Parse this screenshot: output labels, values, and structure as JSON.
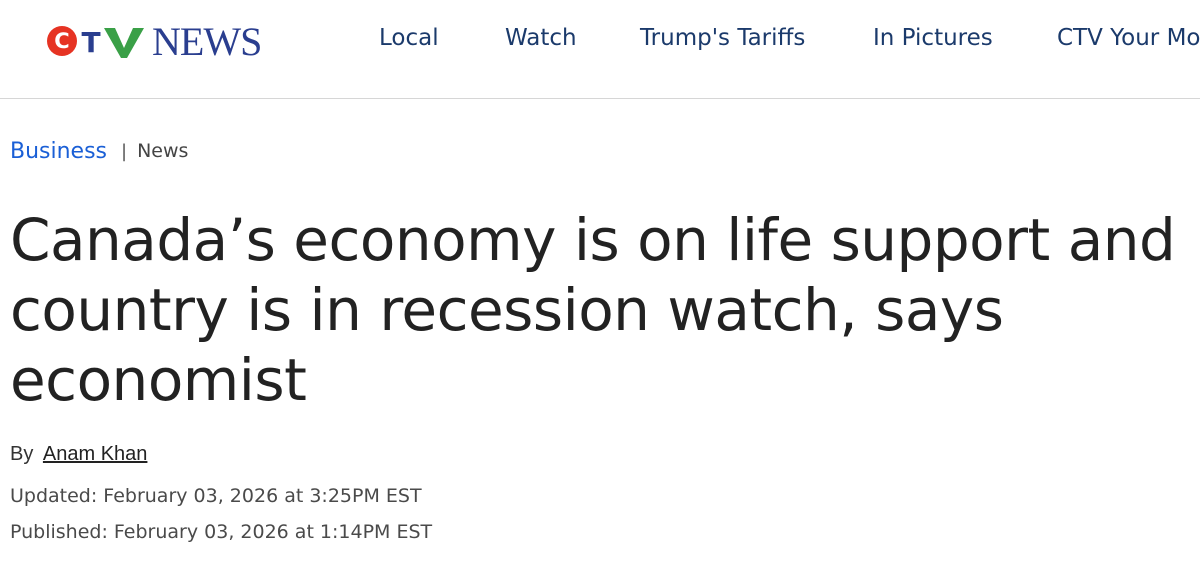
{
  "header": {
    "logo_text": "CTV NEWS",
    "logo_wordmark": "NEWS",
    "nav": [
      {
        "label": "Local"
      },
      {
        "label": "Watch"
      },
      {
        "label": "Trump's Tariffs"
      },
      {
        "label": "In Pictures"
      },
      {
        "label": "CTV Your Morning"
      }
    ],
    "colors": {
      "logo_red": "#e63323",
      "logo_blue": "#2a3e8f",
      "nav_text": "#1b3a6b"
    }
  },
  "breadcrumb": {
    "section": "Business",
    "separator": "|",
    "subsection": "News",
    "section_color": "#1a5fd6"
  },
  "article": {
    "headline": "Canada’s economy is on life support and country is in recession watch, says economist",
    "byline_prefix": "By",
    "author": "Anam Khan",
    "updated": "Updated: February 03, 2026 at 3:25PM EST",
    "published": "Published: February 03, 2026 at 1:14PM EST"
  }
}
